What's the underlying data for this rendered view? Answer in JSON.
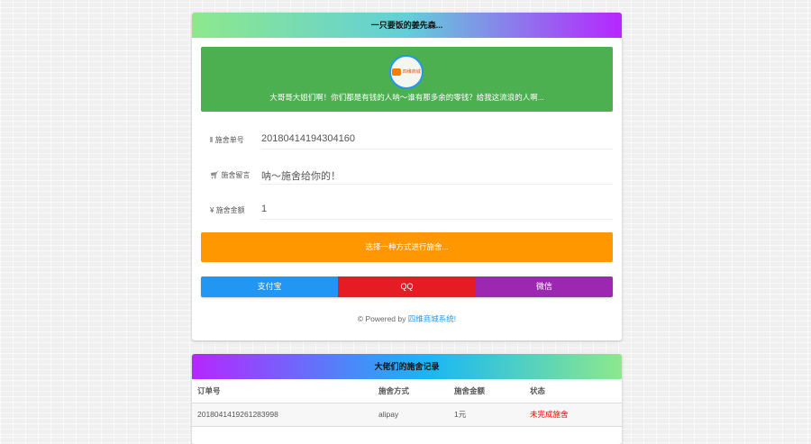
{
  "top_card": {
    "title": "一只要饭的姜先森...",
    "logo_text": "四维商城",
    "slogan": "大哥哥大姐们啊！你们都是有钱的人呐～谁有那多余的零钱？给我这流浪的人啊...",
    "fields": [
      {
        "icon": "barcode-icon",
        "label": "施舍单号",
        "value": "20180414194304160"
      },
      {
        "icon": "cart-icon",
        "label": "施舍留言",
        "value": "呐～施舍给你的！"
      },
      {
        "icon": "yen-icon",
        "label": "施舍金额",
        "value": "1"
      }
    ],
    "choose_label": "选择一种方式进行施舍...",
    "pay_buttons": [
      {
        "label": "支付宝",
        "color": "#2196f3"
      },
      {
        "label": "QQ",
        "color": "#e51c23"
      },
      {
        "label": "微信",
        "color": "#9c27b0"
      }
    ],
    "powered_prefix": "© Powered by",
    "powered_link": "四维商城系统!"
  },
  "records": {
    "title": "大佬们的施舍记录",
    "columns": [
      "订单号",
      "施舍方式",
      "施舍金额",
      "状态"
    ],
    "rows": [
      {
        "order": "20180414192612839​98",
        "method": "alipay",
        "amount": "1元",
        "status": "未完成施舍"
      }
    ]
  }
}
